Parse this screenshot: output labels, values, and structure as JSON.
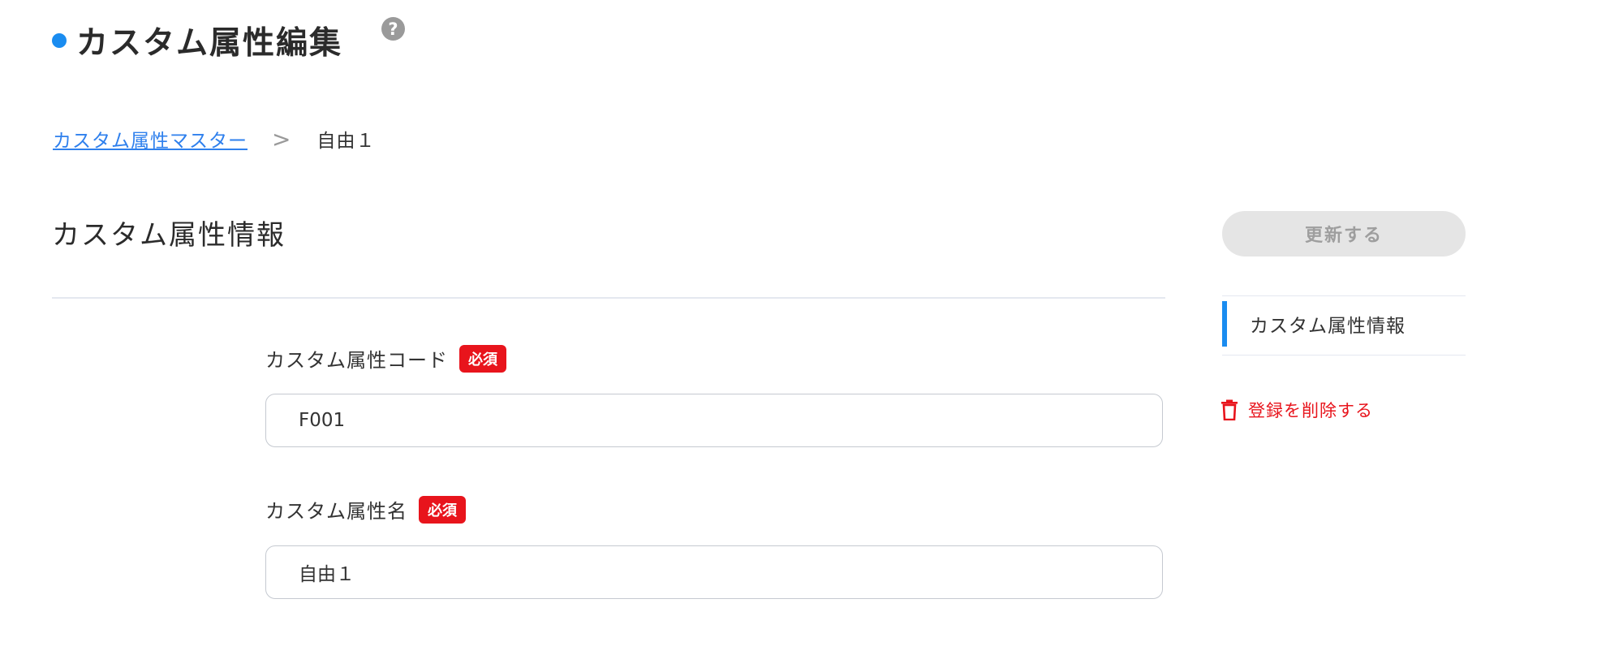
{
  "header": {
    "title": "カスタム属性編集",
    "help_icon": "question-circle-icon",
    "help_glyph": "?",
    "accent_color": "#1a8cf0"
  },
  "breadcrumb": {
    "parent": "カスタム属性マスター",
    "separator": ">",
    "current": "自由１"
  },
  "section": {
    "title": "カスタム属性情報"
  },
  "form": {
    "code": {
      "label": "カスタム属性コード",
      "required": "必須",
      "value": "F001"
    },
    "name": {
      "label": "カスタム属性名",
      "required": "必須",
      "value": "自由１"
    }
  },
  "sidebar": {
    "update_button": "更新する",
    "nav_items": [
      {
        "label": "カスタム属性情報"
      }
    ],
    "delete_label": "登録を削除する",
    "delete_icon": "trash-icon",
    "delete_color": "#e8141c"
  }
}
